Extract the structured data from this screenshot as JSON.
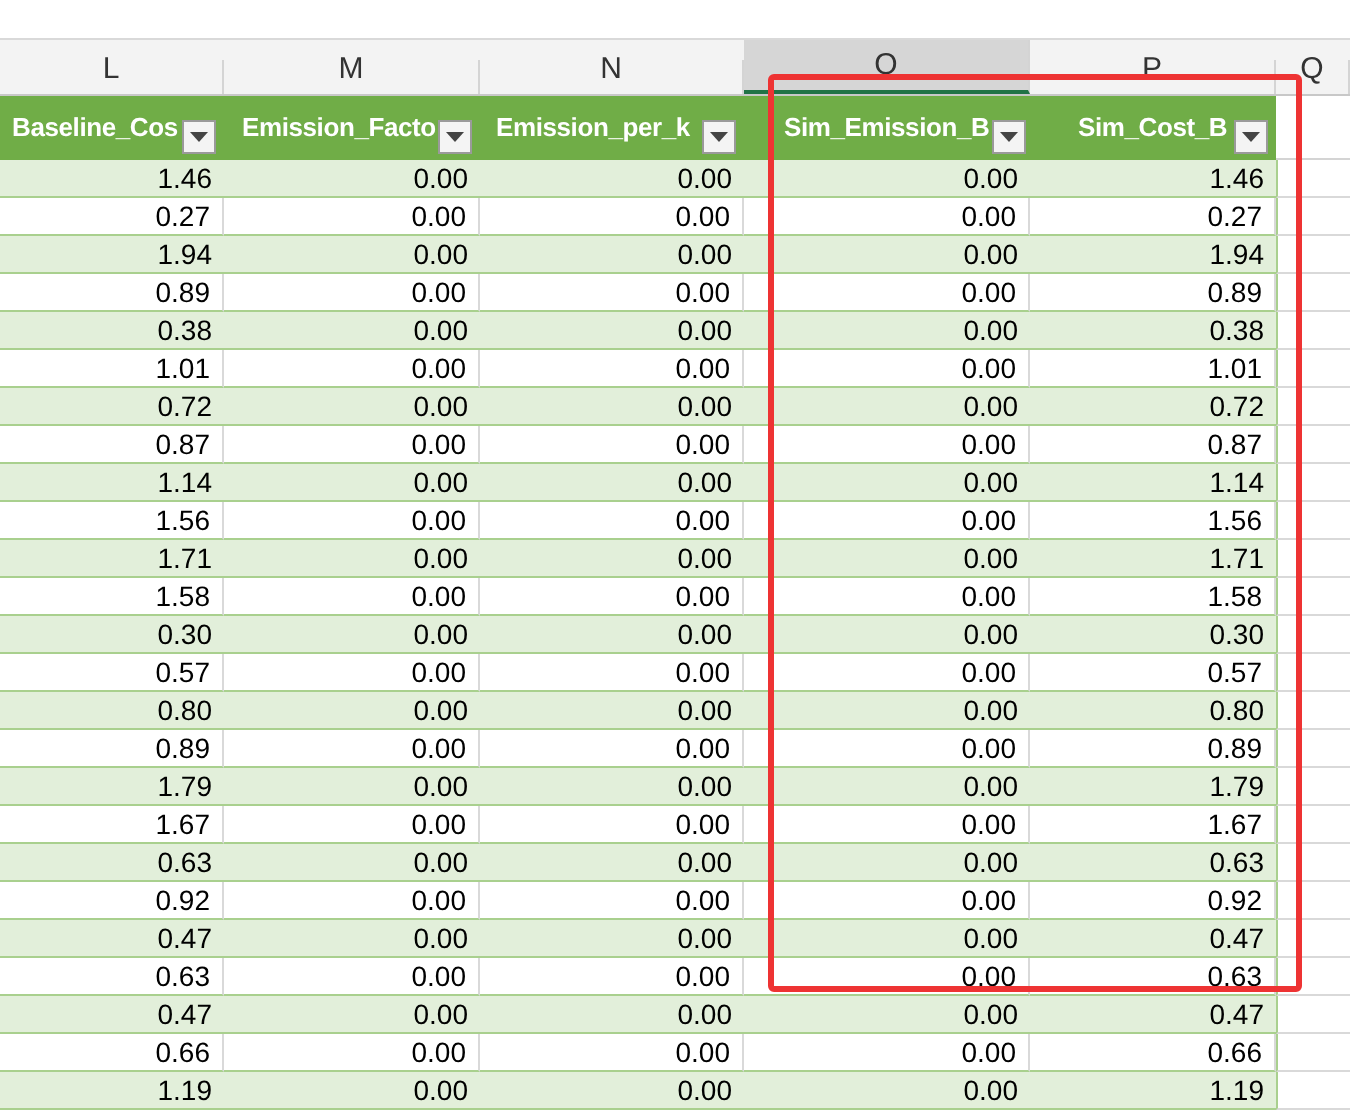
{
  "column_letters": [
    {
      "letter": "L",
      "selected": false
    },
    {
      "letter": "M",
      "selected": false
    },
    {
      "letter": "N",
      "selected": false
    },
    {
      "letter": "O",
      "selected": true
    },
    {
      "letter": "P",
      "selected": false
    },
    {
      "letter": "Q",
      "selected": false
    }
  ],
  "header_cells": [
    "Baseline_Cos",
    "Emission_Facto",
    "Emission_per_k",
    "Sim_Emission_B",
    "Sim_Cost_B"
  ],
  "rows": [
    [
      "1.46",
      "0.00",
      "0.00",
      "0.00",
      "1.46"
    ],
    [
      "0.27",
      "0.00",
      "0.00",
      "0.00",
      "0.27"
    ],
    [
      "1.94",
      "0.00",
      "0.00",
      "0.00",
      "1.94"
    ],
    [
      "0.89",
      "0.00",
      "0.00",
      "0.00",
      "0.89"
    ],
    [
      "0.38",
      "0.00",
      "0.00",
      "0.00",
      "0.38"
    ],
    [
      "1.01",
      "0.00",
      "0.00",
      "0.00",
      "1.01"
    ],
    [
      "0.72",
      "0.00",
      "0.00",
      "0.00",
      "0.72"
    ],
    [
      "0.87",
      "0.00",
      "0.00",
      "0.00",
      "0.87"
    ],
    [
      "1.14",
      "0.00",
      "0.00",
      "0.00",
      "1.14"
    ],
    [
      "1.56",
      "0.00",
      "0.00",
      "0.00",
      "1.56"
    ],
    [
      "1.71",
      "0.00",
      "0.00",
      "0.00",
      "1.71"
    ],
    [
      "1.58",
      "0.00",
      "0.00",
      "0.00",
      "1.58"
    ],
    [
      "0.30",
      "0.00",
      "0.00",
      "0.00",
      "0.30"
    ],
    [
      "0.57",
      "0.00",
      "0.00",
      "0.00",
      "0.57"
    ],
    [
      "0.80",
      "0.00",
      "0.00",
      "0.00",
      "0.80"
    ],
    [
      "0.89",
      "0.00",
      "0.00",
      "0.00",
      "0.89"
    ],
    [
      "1.79",
      "0.00",
      "0.00",
      "0.00",
      "1.79"
    ],
    [
      "1.67",
      "0.00",
      "0.00",
      "0.00",
      "1.67"
    ],
    [
      "0.63",
      "0.00",
      "0.00",
      "0.00",
      "0.63"
    ],
    [
      "0.92",
      "0.00",
      "0.00",
      "0.00",
      "0.92"
    ],
    [
      "0.47",
      "0.00",
      "0.00",
      "0.00",
      "0.47"
    ],
    [
      "0.63",
      "0.00",
      "0.00",
      "0.00",
      "0.63"
    ],
    [
      "0.47",
      "0.00",
      "0.00",
      "0.00",
      "0.47"
    ],
    [
      "0.66",
      "0.00",
      "0.00",
      "0.00",
      "0.66"
    ],
    [
      "1.19",
      "0.00",
      "0.00",
      "0.00",
      "1.19"
    ]
  ]
}
